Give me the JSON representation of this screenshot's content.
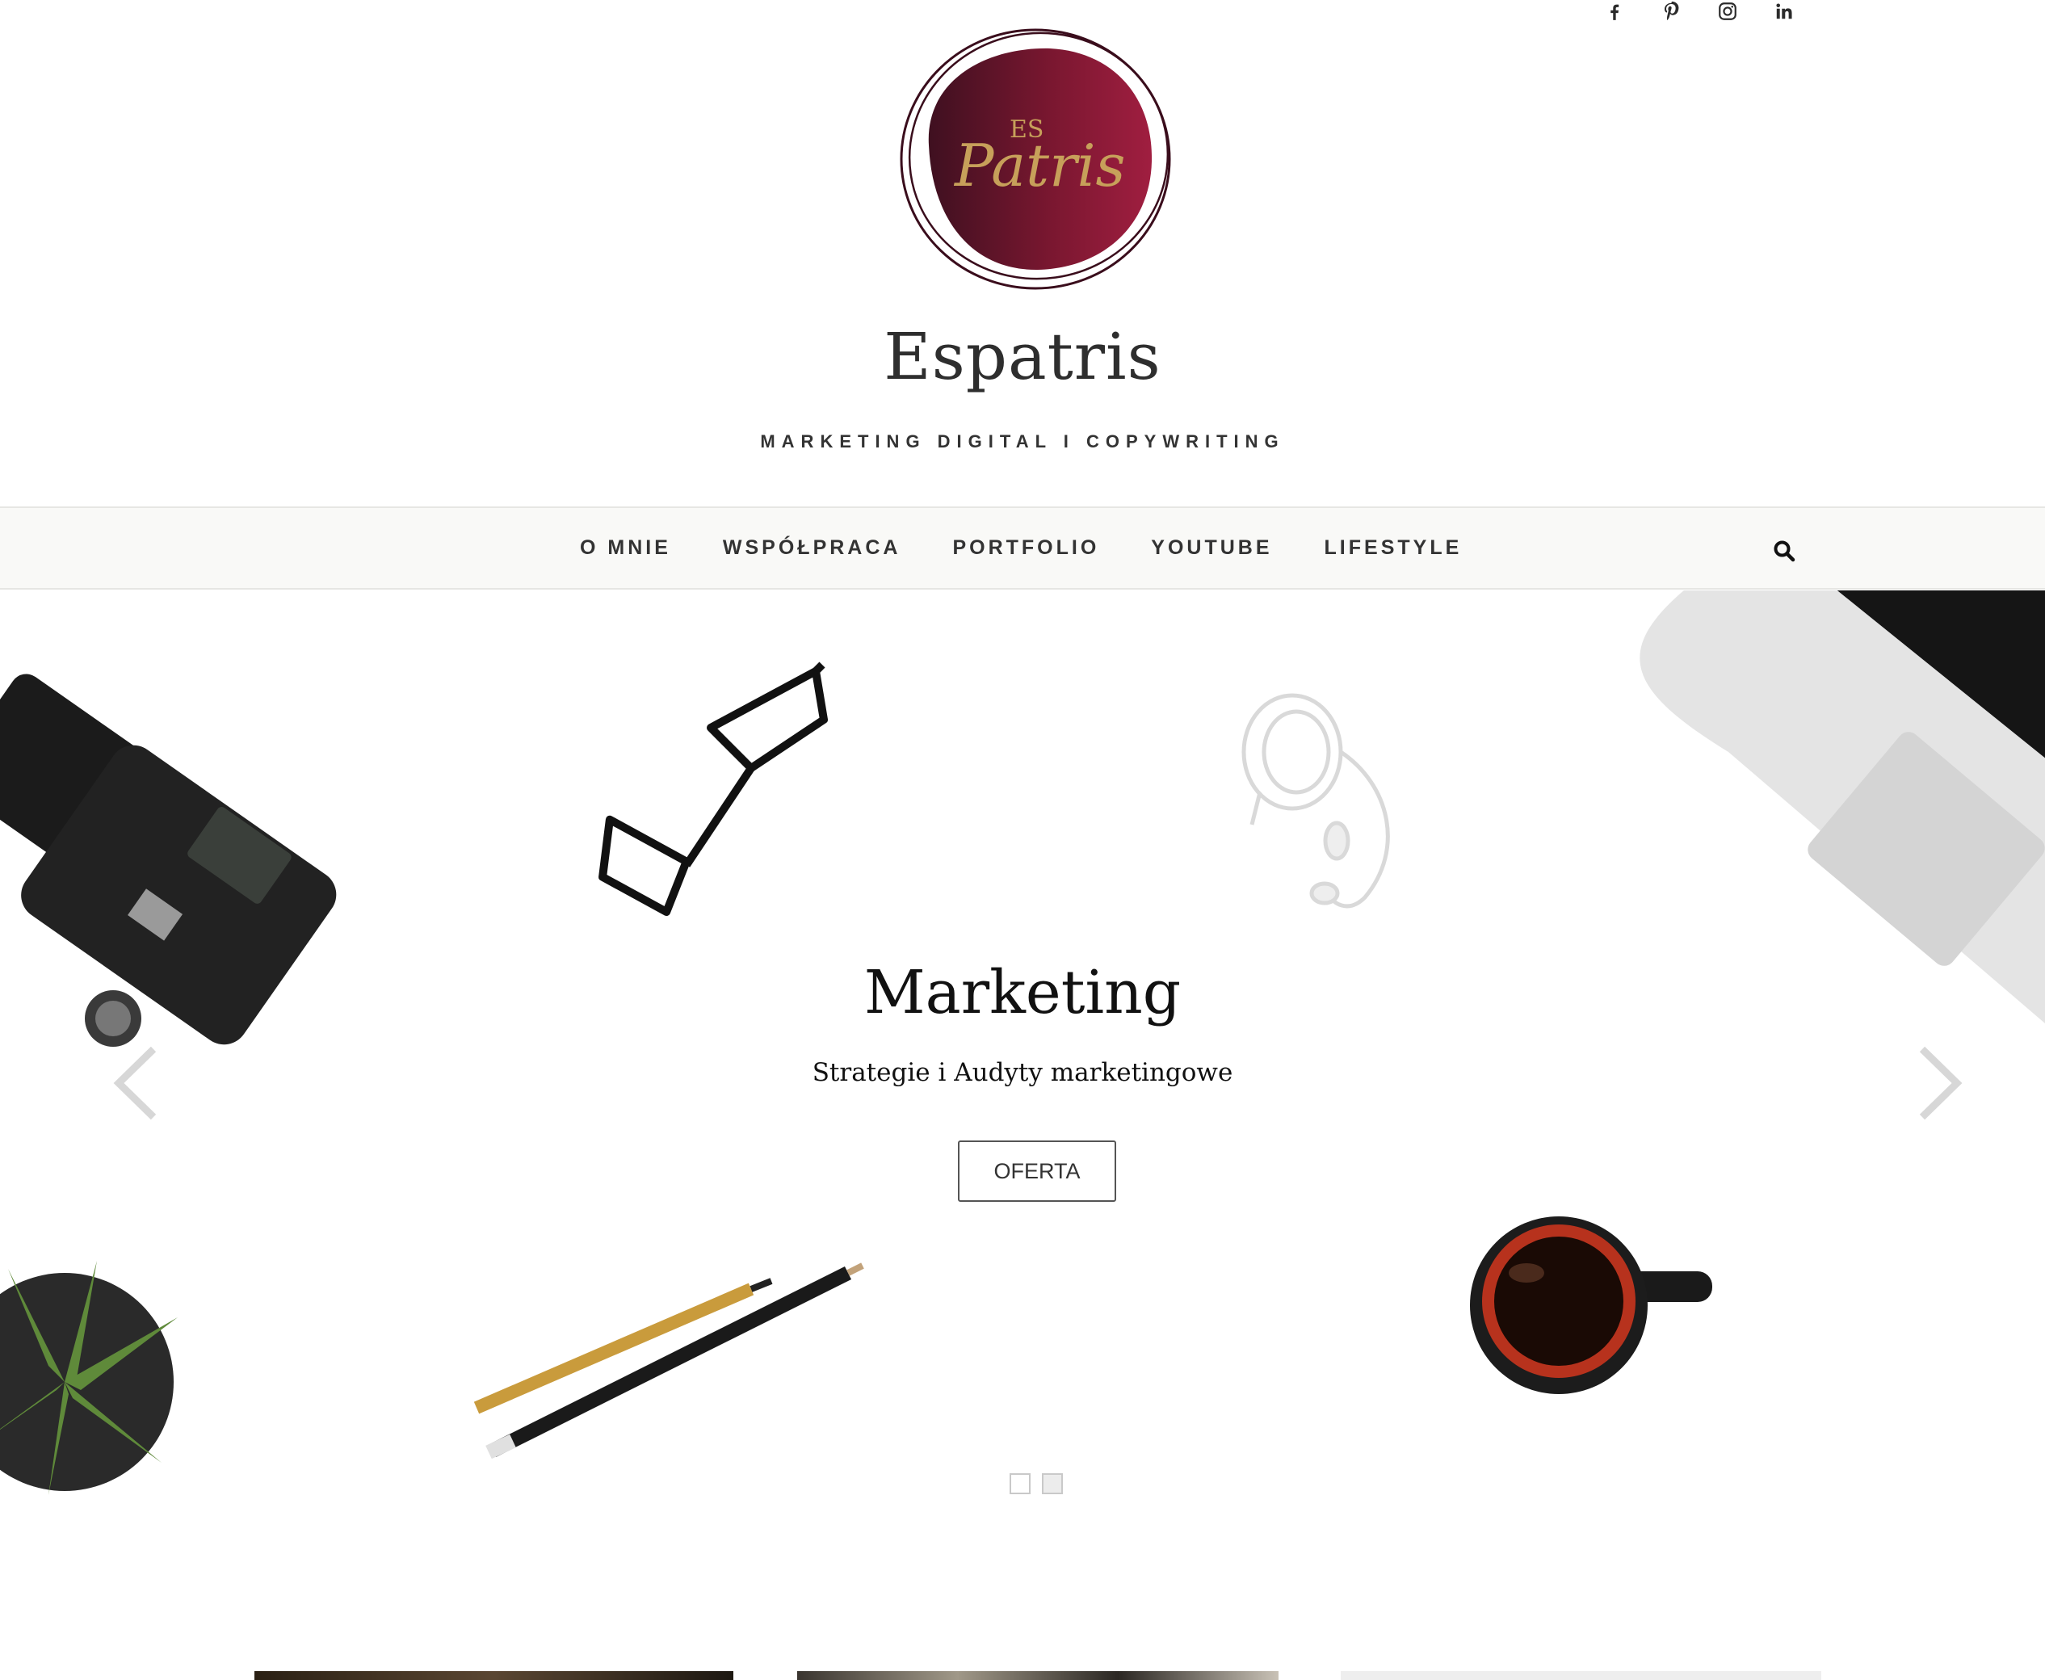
{
  "header": {
    "logo_text": "Patris",
    "logo_monogram": "ES",
    "site_title": "Espatris",
    "tagline": "MARKETING DIGITAL I COPYWRITING"
  },
  "social": [
    {
      "name": "facebook",
      "icon": "facebook-icon"
    },
    {
      "name": "pinterest",
      "icon": "pinterest-icon"
    },
    {
      "name": "instagram",
      "icon": "instagram-icon"
    },
    {
      "name": "linkedin",
      "icon": "linkedin-icon"
    }
  ],
  "nav": {
    "items": [
      {
        "label": "O MNIE"
      },
      {
        "label": "WSPÓŁPRACA"
      },
      {
        "label": "PORTFOLIO"
      },
      {
        "label": "YOUTUBE"
      },
      {
        "label": "LIFESTYLE"
      }
    ],
    "search_icon": "search-icon"
  },
  "hero": {
    "title": "Marketing",
    "subtitle": "Strategie i Audyty marketingowe",
    "button_label": "OFERTA",
    "slides_total": 2,
    "active_slide": 2
  },
  "colors": {
    "logo_dark": "#4a1424",
    "logo_light": "#9b1f3e",
    "logo_gold": "#c7a05a",
    "nav_bg": "#f9f9f7"
  }
}
